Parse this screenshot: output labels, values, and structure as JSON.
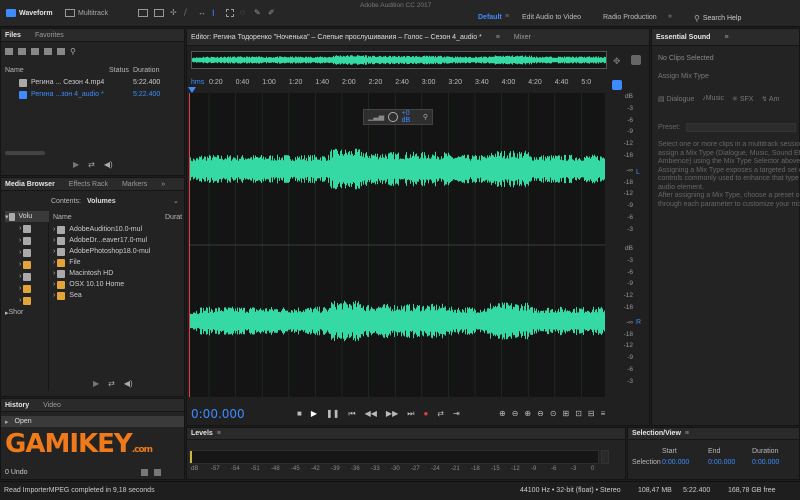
{
  "toolbar": {
    "waveform_label": "Waveform",
    "multitrack_label": "Multitrack",
    "app_title": "Adobe Audition CC 2017",
    "workspaces": [
      "Default",
      "Edit Audio to Video",
      "Radio Production"
    ],
    "search_placeholder": "Search Help"
  },
  "files_panel": {
    "tabs": [
      "Files",
      "Favorites"
    ],
    "columns": [
      "Name",
      "Status",
      "Duration"
    ],
    "rows": [
      {
        "name": "Регина ... Сезон 4.mp4",
        "duration": "5:22.400"
      },
      {
        "name": "Регина ...зон 4_audio *",
        "duration": "5:22.400"
      }
    ]
  },
  "media_panel": {
    "tabs": [
      "Media Browser",
      "Effects Rack",
      "Markers"
    ],
    "contents_label": "Contents:",
    "contents_value": "Volumes",
    "columns": [
      "Name",
      "Durat"
    ],
    "tree": [
      "Volu",
      "",
      "",
      "",
      "",
      "",
      "",
      "Shor"
    ],
    "items": [
      "AdobeAudition10.0-mul",
      "AdobeDr...eaver17.0-mul",
      "AdobePhotoshop18.0-mul",
      "File",
      "Macintosh HD",
      "OSX 10.10 Home",
      "Sea"
    ]
  },
  "history_panel": {
    "tabs": [
      "History",
      "Video"
    ],
    "open_item": "Open",
    "undo_count": "0 Undo"
  },
  "status_bar": {
    "message": "Read ImporterMPEG completed in 9,18 seconds",
    "format": "44100 Hz • 32-bit (float) • Stereo",
    "size": "108,47 MB",
    "duration": "5:22.400",
    "free": "168,78 GB free"
  },
  "editor": {
    "tab_label": "Editor: Регина Тодоренко \"Ноченька\" – Слепые прослушивания – Голос – Сезон 4_audio *",
    "mixer_label": "Mixer",
    "time_unit": "hms",
    "ruler_labels": [
      "0:20",
      "0:40",
      "1:00",
      "1:20",
      "1:40",
      "2:00",
      "2:20",
      "2:40",
      "3:00",
      "3:20",
      "3:40",
      "4:00",
      "4:20",
      "4:40",
      "5:0"
    ],
    "volume_hud": "+0 dB",
    "db_scale": [
      "dB",
      "-3",
      "-6",
      "-9",
      "-12",
      "-18",
      "-∞",
      "-18",
      "-12",
      "-9",
      "-6",
      "-3"
    ],
    "channels": [
      "L",
      "R"
    ],
    "current_time": "0:00.000"
  },
  "essential_sound": {
    "title": "Essential Sound",
    "no_clips": "No Clips Selected",
    "assign_label": "Assign Mix Type",
    "types": [
      "Dialogue",
      "Music",
      "SFX",
      "Am"
    ],
    "preset_label": "Preset:",
    "help_lines": [
      "Select one or more clips in a multitrack session",
      "assign a Mix Type (Dialogue, Music, Sound Effe",
      "Ambience) using the Mix Type Selector above.",
      "controls commonly used to enhance that type o",
      "audio element.",
      "After assigning a Mix Type, choose a preset or",
      "through each parameter to customize your mix."
    ],
    "help_lines_first": [
      "Assigning a Mix Type exposes a targeted set of"
    ]
  },
  "levels_panel": {
    "title": "Levels",
    "scale": [
      "dB",
      "-57",
      "-54",
      "-51",
      "-48",
      "-45",
      "-42",
      "-39",
      "-36",
      "-33",
      "-30",
      "-27",
      "-24",
      "-21",
      "-18",
      "-15",
      "-12",
      "-9",
      "-6",
      "-3",
      "0"
    ]
  },
  "selection_panel": {
    "title": "Selection/View",
    "headers": [
      "Start",
      "End",
      "Duration"
    ],
    "row_label": "Selection",
    "values": [
      "0:00.000",
      "0:00.000",
      "0:00.000"
    ]
  },
  "watermark": "GAMIKEY.com",
  "colors": {
    "accent": "#3c8cff",
    "waveform": "#34d9a4",
    "playhead": "#e0413a"
  }
}
